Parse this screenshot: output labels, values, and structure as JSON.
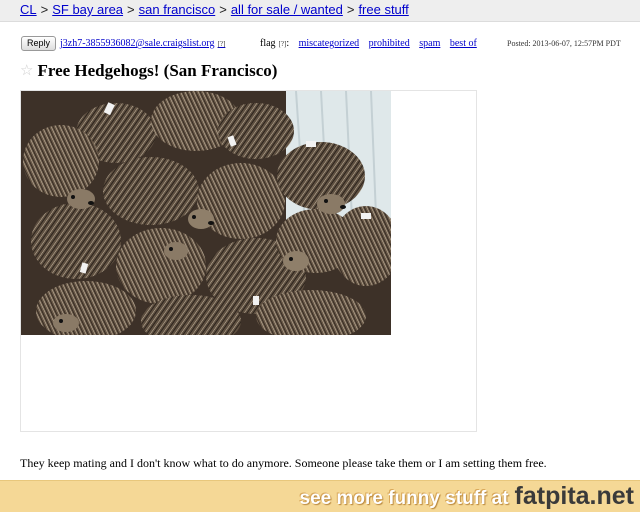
{
  "breadcrumb": {
    "items": [
      "CL",
      "SF bay area",
      "san francisco",
      "all for sale / wanted",
      "free stuff"
    ],
    "separator": ">"
  },
  "postinfo": {
    "reply_label": "Reply",
    "email": "j3zh7-3855936082@sale.craigslist.org",
    "email_sup": "[?]",
    "flag_label": "flag",
    "flag_sup": "[?]",
    "flag_colon": ":",
    "flag_options": [
      "miscategorized",
      "prohibited",
      "spam",
      "best of"
    ],
    "posted": "Posted: 2013-06-07, 12:57PM PDT"
  },
  "posting": {
    "star_icon": "star-icon",
    "title": "Free Hedgehogs! (San Francisco)",
    "body": "They keep mating and I don't know what to do anymore. Someone please take them or I am setting them free."
  },
  "footer": {
    "prefix": "see more funny stuff at",
    "site": "fatpita.net"
  },
  "colors": {
    "link": "#0000cc",
    "breadcrumb_bg": "#eeeeee",
    "footer_bg": "#f5d896"
  }
}
